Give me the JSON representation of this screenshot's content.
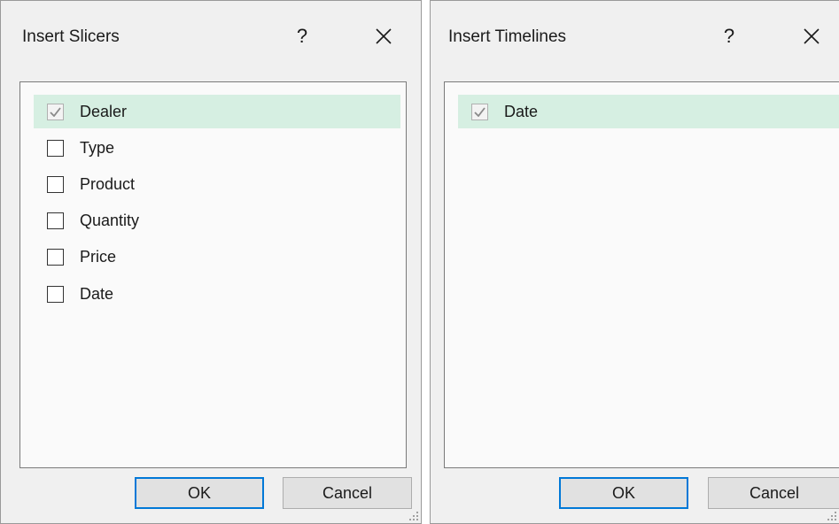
{
  "slicers": {
    "title": "Insert Slicers",
    "help": "?",
    "close_icon": "close-icon",
    "items": [
      {
        "label": "Dealer",
        "checked": true
      },
      {
        "label": "Type",
        "checked": false
      },
      {
        "label": "Product",
        "checked": false
      },
      {
        "label": "Quantity",
        "checked": false
      },
      {
        "label": "Price",
        "checked": false
      },
      {
        "label": "Date",
        "checked": false
      }
    ],
    "ok": "OK",
    "cancel": "Cancel"
  },
  "timelines": {
    "title": "Insert Timelines",
    "help": "?",
    "close_icon": "close-icon",
    "items": [
      {
        "label": "Date",
        "checked": true
      }
    ],
    "ok": "OK",
    "cancel": "Cancel"
  },
  "colors": {
    "selection": "#d6efe2",
    "default_button_border": "#0078d7"
  }
}
